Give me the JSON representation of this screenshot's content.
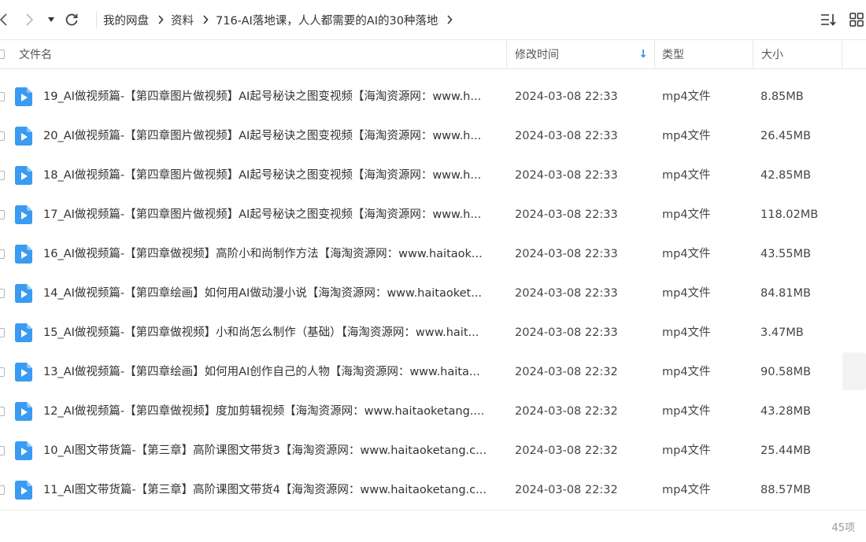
{
  "nav": {
    "back_icon": "chevron-left-icon",
    "forward_icon": "chevron-right-icon",
    "history_icon": "caret-down-icon",
    "refresh_icon": "refresh-icon",
    "breadcrumb": [
      "我的网盘",
      "资料",
      "716-AI落地课，人人都需要的AI的30种落地"
    ],
    "sort_icon": "sort-list-icon",
    "view_icon": "grid-view-icon"
  },
  "columns": {
    "name": "文件名",
    "modified": "修改时间",
    "type": "类型",
    "size": "大小",
    "sort_indicator": "↓"
  },
  "files": [
    {
      "name": "19_AI做视频篇-【第四章图片做视频】AI起号秘诀之图变视频【海淘资源网：www.h...",
      "modified": "2024-03-08 22:33",
      "type": "mp4文件",
      "size": "8.85MB"
    },
    {
      "name": "20_AI做视频篇-【第四章图片做视频】AI起号秘诀之图变视频【海淘资源网：www.h...",
      "modified": "2024-03-08 22:33",
      "type": "mp4文件",
      "size": "26.45MB"
    },
    {
      "name": "18_AI做视频篇-【第四章图片做视频】AI起号秘诀之图变视频【海淘资源网：www.h...",
      "modified": "2024-03-08 22:33",
      "type": "mp4文件",
      "size": "42.85MB"
    },
    {
      "name": "17_AI做视频篇-【第四章图片做视频】AI起号秘诀之图变视频【海淘资源网：www.h...",
      "modified": "2024-03-08 22:33",
      "type": "mp4文件",
      "size": "118.02MB"
    },
    {
      "name": "16_AI做视频篇-【第四章做视频】高阶小和尚制作方法【海淘资源网：www.haitaok...",
      "modified": "2024-03-08 22:33",
      "type": "mp4文件",
      "size": "43.55MB"
    },
    {
      "name": "14_AI做视频篇-【第四章绘画】如何用AI做动漫小说【海淘资源网：www.haitaoket...",
      "modified": "2024-03-08 22:33",
      "type": "mp4文件",
      "size": "84.81MB"
    },
    {
      "name": "15_AI做视频篇-【第四章做视频】小和尚怎么制作（基础）【海淘资源网：www.hait...",
      "modified": "2024-03-08 22:33",
      "type": "mp4文件",
      "size": "3.47MB"
    },
    {
      "name": "13_AI做视频篇-【第四章绘画】如何用AI创作自己的人物【海淘资源网：www.haita...",
      "modified": "2024-03-08 22:32",
      "type": "mp4文件",
      "size": "90.58MB"
    },
    {
      "name": "12_AI做视频篇-【第四章做视频】度加剪辑视频【海淘资源网：www.haitaoketang....",
      "modified": "2024-03-08 22:32",
      "type": "mp4文件",
      "size": "43.28MB"
    },
    {
      "name": "10_AI图文带货篇-【第三章】高阶课图文带货3【海淘资源网：www.haitaoketang.c...",
      "modified": "2024-03-08 22:32",
      "type": "mp4文件",
      "size": "25.44MB"
    },
    {
      "name": "11_AI图文带货篇-【第三章】高阶课图文带货4【海淘资源网：www.haitaoketang.c...",
      "modified": "2024-03-08 22:32",
      "type": "mp4文件",
      "size": "88.57MB"
    }
  ],
  "file_icon": "video-file-icon",
  "footer": {
    "count": "45项"
  },
  "colors": {
    "accent": "#2e8ff0",
    "icon_fill": "#3b9af2",
    "muted": "#999999"
  }
}
